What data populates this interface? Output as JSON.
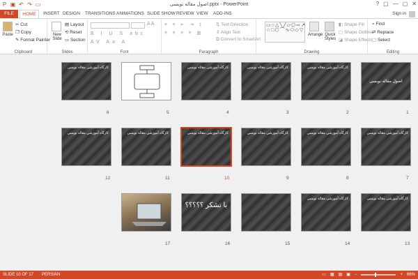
{
  "window": {
    "title": "اصول مقاله نویسی.pptx - PowerPoint",
    "controls": [
      "?",
      "▢",
      "—",
      "▢",
      "✕"
    ]
  },
  "tabs": [
    "FILE",
    "HOME",
    "INSERT",
    "DESIGN",
    "TRANSITIONS",
    "ANIMATIONS",
    "SLIDE SHOW",
    "REVIEW",
    "VIEW",
    "ADD-INS"
  ],
  "signin": "Sign in",
  "ribbon": {
    "clipboard": {
      "paste": "Paste",
      "cut": "Cut",
      "copy": "Copy",
      "format_painter": "Format Painter",
      "label": "Clipboard"
    },
    "slides": {
      "new_slide": "New Slide",
      "layout": "Layout",
      "reset": "Reset",
      "section": "Section",
      "label": "Slides"
    },
    "font": {
      "label": "Font"
    },
    "paragraph": {
      "text_direction": "Text Direction",
      "align_text": "Align Text",
      "convert": "Convert to SmartArt",
      "label": "Paragraph"
    },
    "drawing": {
      "arrange": "Arrange",
      "quick_styles": "Quick Styles",
      "shape_fill": "Shape Fill",
      "shape_outline": "Shape Outline",
      "shape_effects": "Shape Effects",
      "label": "Drawing"
    },
    "editing": {
      "find": "Find",
      "replace": "Replace",
      "select": "Select",
      "label": "Editing"
    }
  },
  "slides": [
    {
      "num": "1",
      "title": "اصول مقاله نویسی"
    },
    {
      "num": "2",
      "title": "کارگاه آموزشی مقاله نویسی"
    },
    {
      "num": "3",
      "title": "کارگاه آموزشی مقاله نویسی"
    },
    {
      "num": "4",
      "title": "کارگاه آموزشی مقاله نویسی"
    },
    {
      "num": "5",
      "title": ""
    },
    {
      "num": "6",
      "title": "کارگاه آموزشی مقاله نویسی"
    },
    {
      "num": "7",
      "title": "کارگاه آموزشی مقاله نویسی"
    },
    {
      "num": "8",
      "title": "کارگاه آموزشی مقاله نویسی"
    },
    {
      "num": "9",
      "title": "کارگاه آموزشی مقاله نویسی"
    },
    {
      "num": "10",
      "title": "کارگاه آموزشی مقاله نویسی"
    },
    {
      "num": "11",
      "title": "کارگاه آموزشی مقاله نویسی"
    },
    {
      "num": "12",
      "title": "کارگاه آموزشی مقاله نویسی"
    },
    {
      "num": "13",
      "title": "کارگاه آموزشی مقاله نویسی"
    },
    {
      "num": "14",
      "title": "کارگاه آموزشی مقاله نویسی"
    },
    {
      "num": "15",
      "title": ""
    },
    {
      "num": "16",
      "title": "با تشکر ؟؟؟؟؟"
    },
    {
      "num": "17",
      "title": ""
    }
  ],
  "selected_slide": "10",
  "status": {
    "slide_info": "SLIDE 10 OF 17",
    "language": "PERSIAN",
    "zoom": "66%"
  },
  "colors": {
    "accent": "#d24726",
    "selected_border": "#d24726"
  }
}
